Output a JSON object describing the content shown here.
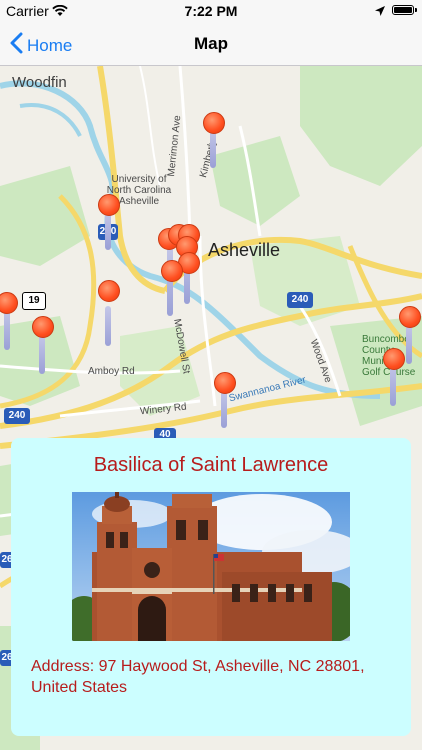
{
  "status_bar": {
    "carrier": "Carrier",
    "time": "7:22 PM"
  },
  "nav": {
    "back_label": "Home",
    "title": "Map"
  },
  "map": {
    "labels": {
      "woodfin": "Woodfin",
      "unc": "University of North Carolina Asheville",
      "asheville": "Asheville",
      "merrimon": "Merrimon Ave",
      "kimberly": "Kimberly",
      "mcdowell": "McDowell St",
      "amboy": "Amboy Rd",
      "winery": "Winery Rd",
      "swannanoa": "Swannanoa River",
      "wood": "Wood Ave",
      "buncombe": "Buncombe County Municipal Golf Course",
      "i240a": "240",
      "i240b": "240",
      "us19": "19",
      "i40": "40",
      "i26": "26",
      "i26b": "26"
    }
  },
  "info_card": {
    "name": "Basilica of Saint Lawrence",
    "address": "Address: 97 Haywood St, Asheville, NC 28801, United States"
  }
}
